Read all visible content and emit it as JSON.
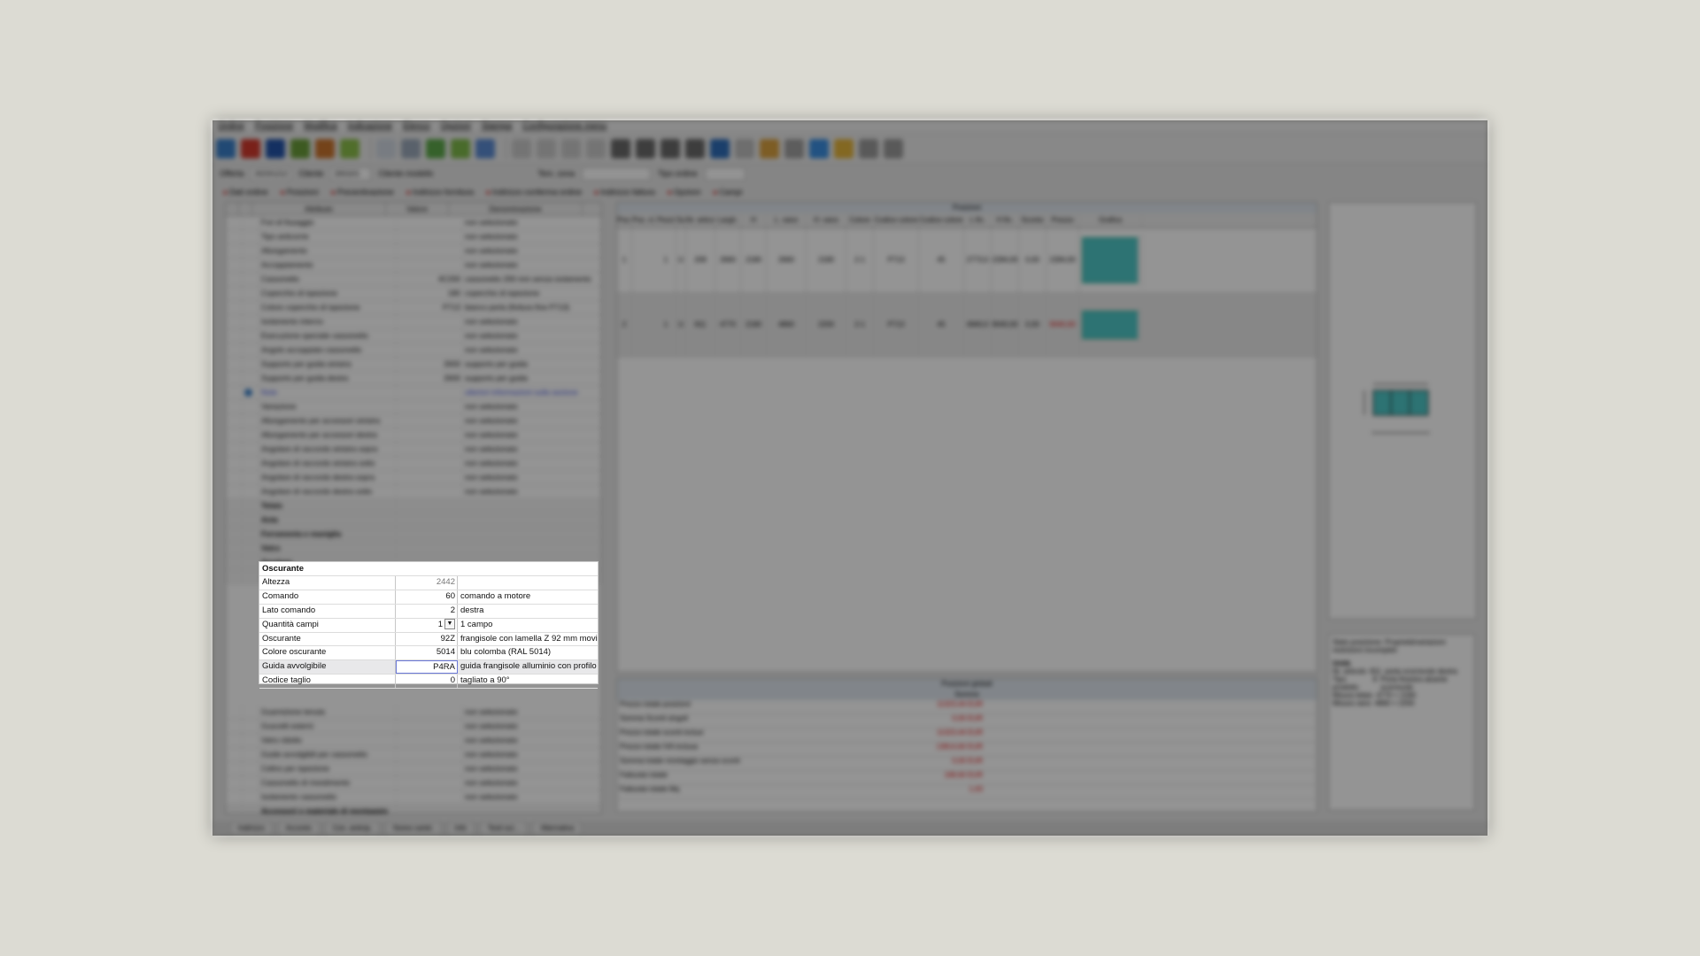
{
  "menu": [
    "Ordine",
    "Posizione",
    "Modifica",
    "Indicazione",
    "Elenco",
    "Opzioni",
    "Stampa",
    "Configurazione menu"
  ],
  "infobar": {
    "label_offerta": "Offerta",
    "offerta": "2023/1212",
    "label_cliente": "Cliente",
    "cliente_code": "20010/1",
    "cliente_name": "Cliente modello",
    "label_zona": "Tem. zona",
    "label_tipo": "Tipo ordine"
  },
  "tabs": [
    "Dati ordine",
    "Posizioni",
    "Preventivazione",
    "Indirizzo fornitura",
    "Indirizzo conferma ordine",
    "Indirizzo fattura",
    "Opzioni",
    "Campi"
  ],
  "left_header": {
    "attr": "Attributo",
    "val": "Valore",
    "desc": "Denominazione"
  },
  "left_rows": [
    {
      "a": "Fori di fissaggio",
      "v": "",
      "d": "non selezionato"
    },
    {
      "a": "Tipo anticorrie",
      "v": "",
      "d": "non selezionato"
    },
    {
      "a": "Allungamento",
      "v": "",
      "d": "non selezionato"
    },
    {
      "a": "Accoppiamento",
      "v": "",
      "d": "non selezionato"
    },
    {
      "a": "Cassonetto",
      "v": "4C200",
      "d": "cassonetto 200 mm senza isolamento"
    },
    {
      "a": "Coperchio di ispezione",
      "v": "180",
      "d": "coperchio di ispezione"
    },
    {
      "a": "Colore coperchio di ispezione",
      "v": "P713",
      "d": "bianco perla (finitura fine P713)"
    },
    {
      "a": "Isolamento interno",
      "v": "",
      "d": "non selezionato"
    },
    {
      "a": "Esecuzione speciale cassonetto",
      "v": "",
      "d": "non selezionato"
    },
    {
      "a": "Angolo accoppiato cassonetto",
      "v": "",
      "d": "non selezionato"
    },
    {
      "a": "Supporto per guida sinistra",
      "v": "2600",
      "d": "supporto per guida"
    },
    {
      "a": "Supporto per guida destra",
      "v": "2600",
      "d": "supporto per guida"
    },
    {
      "a": "Note",
      "v": "",
      "d": "ulteriori informazioni sulla sezione"
    },
    {
      "a": "Variazione",
      "v": "",
      "d": "non selezionato"
    },
    {
      "a": "Allungamento per accessori sinistra",
      "v": "",
      "d": "non selezionato"
    },
    {
      "a": "Allungamento per accessori destra",
      "v": "",
      "d": "non selezionato"
    },
    {
      "a": "Angolare di raccordo sinistra sopra",
      "v": "",
      "d": "non selezionato"
    },
    {
      "a": "Angolare di raccordo sinistra sotto",
      "v": "",
      "d": "non selezionato"
    },
    {
      "a": "Angolare di raccordo destra sopra",
      "v": "",
      "d": "non selezionato"
    },
    {
      "a": "Angolare di raccordo destra sotto",
      "v": "",
      "d": "non selezionato"
    }
  ],
  "left_groups": [
    "Telaio",
    "Anta",
    "Ferramenta e maniglia",
    "Vetro",
    "Aeratore",
    "Zanzariera"
  ],
  "left_rows_after": [
    {
      "a": "Guarnizione tenuta",
      "v": "",
      "d": "non selezionato"
    },
    {
      "a": "Guscetti esterni",
      "v": "",
      "d": "non selezionato"
    },
    {
      "a": "Vetro ridotto",
      "v": "",
      "d": "non selezionato"
    },
    {
      "a": "Guide avvolgibili per cassonetto",
      "v": "",
      "d": "non selezionato"
    },
    {
      "a": "Celino per ispezione",
      "v": "",
      "d": "non selezionato"
    },
    {
      "a": "Cassonetto di rivestimento",
      "v": "",
      "d": "non selezionato"
    },
    {
      "a": "Isolamento cassonetto",
      "v": "",
      "d": "non selezionato"
    }
  ],
  "left_groups_after": [
    "Accessori e materiale di montaggio",
    "Prestazioni di montaggio"
  ],
  "positions": {
    "title": "Posizioni",
    "headers": [
      "Pos.",
      "Pos. cl.",
      "Pezzi",
      "Sup.",
      "Nr. articolo",
      "Largh.",
      "H",
      "L. vano",
      "H. vano",
      "Colore",
      "Codice colore",
      "Codice colore",
      "L fin.",
      "H fin.",
      "Sconto",
      "Prezzo",
      "Grafica"
    ],
    "rows": [
      {
        "pos": "1",
        "pezzi": "1",
        "sup": "U",
        "art": "208",
        "largh": "2660",
        "h": "2180",
        "lvano": "2660",
        "hvano": "2180",
        "col": "2-1",
        "cc1": "P713",
        "cc2": "45",
        "lf": "2773,0",
        "hf": "2284,00",
        "sc": "0,00",
        "prezzo": "2284,00"
      },
      {
        "pos": "2",
        "pezzi": "1",
        "sup": "U",
        "art": "811",
        "largh": "4770",
        "h": "2180",
        "lvano": "4860",
        "hvano": "2200",
        "col": "2-1",
        "cc1": "P713",
        "cc2": "45",
        "lf": "4940,0",
        "hf": "9040,00",
        "sc": "0,00",
        "prezzo": "9040,00"
      }
    ]
  },
  "totals": {
    "global_title": "Posizioni globali",
    "sum_title": "Somme",
    "rows": [
      {
        "label": "Prezzo totale posizioni",
        "value": "11323,44 EUR"
      },
      {
        "label": "Somma Sconti singoli",
        "value": "0,00 EUR"
      },
      {
        "label": "Prezzo totale sconti inclusi",
        "value": "11323,44 EUR"
      },
      {
        "label": "Prezzo totale IVA inclusa",
        "value": "13814,60 EUR"
      },
      {
        "label": "Somma totale montaggio senza sconti",
        "value": "0,00 EUR"
      },
      {
        "label": "Fatturato totale",
        "value": "168,60 EUR"
      },
      {
        "label": "Fatturato totale Mq",
        "value": "1,63"
      }
    ]
  },
  "info_panel": {
    "status": "Stato posizione: Proprietà/variazioni restrizioni incompleti",
    "unit_label": "Unità",
    "nr_label": "Nr. articolo",
    "nr": "811",
    "nr_desc": "porta scorrevole destra",
    "tipo_label": "Tipo prodotto",
    "tipo": "8",
    "tipo_desc": "Porta finestra alzante scorrevole",
    "mis_label": "Misura telaio",
    "mis": "4770 × 2180",
    "vano_label": "Misura vano",
    "vano": "4860 × 2200"
  },
  "statusbar": [
    "Indirizzo",
    "Acconto",
    "Con. anticip.",
    "Nome cartel.",
    "Info",
    "Testi sul...",
    "Alternativa"
  ],
  "focus_panel": {
    "title": "Oscurante",
    "rows": [
      {
        "name": "altezza",
        "attr": "Altezza",
        "val": "2442",
        "desc": ""
      },
      {
        "name": "comando",
        "attr": "Comando",
        "val": "60",
        "desc": "comando a motore"
      },
      {
        "name": "lato-comando",
        "attr": "Lato comando",
        "val": "2",
        "desc": "destra"
      },
      {
        "name": "quantita-campi",
        "attr": "Quantità campi",
        "val": "1",
        "desc": "1 campo"
      },
      {
        "name": "oscurante",
        "attr": "Oscurante",
        "val": "92Z",
        "desc": "frangisole con lamella Z 92 mm movim"
      },
      {
        "name": "colore-oscurante",
        "attr": "Colore oscurante",
        "val": "5014",
        "desc": "blu colomba (RAL 5014)"
      },
      {
        "name": "guida-avvolgibile",
        "attr": "Guida avvolgibile",
        "val": "P4RA",
        "desc": "guida frangisole alluminio con profilo"
      },
      {
        "name": "codice-taglio",
        "attr": "Codice taglio",
        "val": "0",
        "desc": "tagliato a 90°"
      }
    ]
  }
}
